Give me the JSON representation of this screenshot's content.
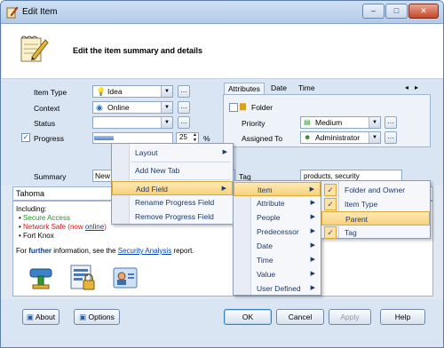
{
  "window": {
    "title": "Edit Item",
    "minimize": "–",
    "maximize": "□",
    "close": "✕"
  },
  "header": {
    "text": "Edit the item summary and details"
  },
  "form": {
    "item_type": {
      "label": "Item Type",
      "value": "Idea"
    },
    "context": {
      "label": "Context",
      "value": "Online"
    },
    "status": {
      "label": "Status",
      "value": ""
    },
    "progress": {
      "label": "Progress",
      "value": "25",
      "unit": "%",
      "fraction": 0.25,
      "checked": true
    },
    "summary": {
      "label": "Summary",
      "value": "New"
    }
  },
  "tabs": {
    "items": [
      "Attributes",
      "Date",
      "Time"
    ],
    "active": "Attributes",
    "prev": "◂",
    "next": "▸"
  },
  "attributes": {
    "folder_label": "Folder",
    "priority": {
      "label": "Priority",
      "value": "Medium"
    },
    "assigned_to": {
      "label": "Assigned To",
      "value": "Administrator"
    },
    "tag": {
      "label": "Tag",
      "value": "products, security"
    }
  },
  "editor": {
    "font": "Tahoma",
    "including": "Including:",
    "bullets": [
      {
        "text": "Secure Access",
        "color": "#1a9a1a"
      },
      {
        "text": "Network Safe (now ",
        "link": "online",
        "after": ")",
        "color": "#d01818"
      },
      {
        "text": "Fort Knox",
        "color": "#000000"
      }
    ],
    "further_pre": "For ",
    "further_bold": "further",
    "further_mid": " information, see the ",
    "further_link": "Security Analysis",
    "further_post": " report."
  },
  "context_menu": {
    "items": [
      "Layout",
      "Add New Tab",
      "Add Field",
      "Rename Progress Field",
      "Remove Progress Field"
    ],
    "highlighted": "Add Field"
  },
  "field_menu": {
    "items": [
      "Item",
      "Attribute",
      "People",
      "Predecessor",
      "Date",
      "Time",
      "Value",
      "User Defined"
    ],
    "highlighted": "Item"
  },
  "item_menu": {
    "items": [
      "Folder and Owner",
      "Item Type",
      "Parent",
      "Tag"
    ],
    "checked": [
      true,
      true,
      false,
      true
    ],
    "highlighted": "Parent"
  },
  "buttons": {
    "about": "About",
    "options": "Options",
    "ok": "OK",
    "cancel": "Cancel",
    "apply": "Apply",
    "help": "Help"
  }
}
